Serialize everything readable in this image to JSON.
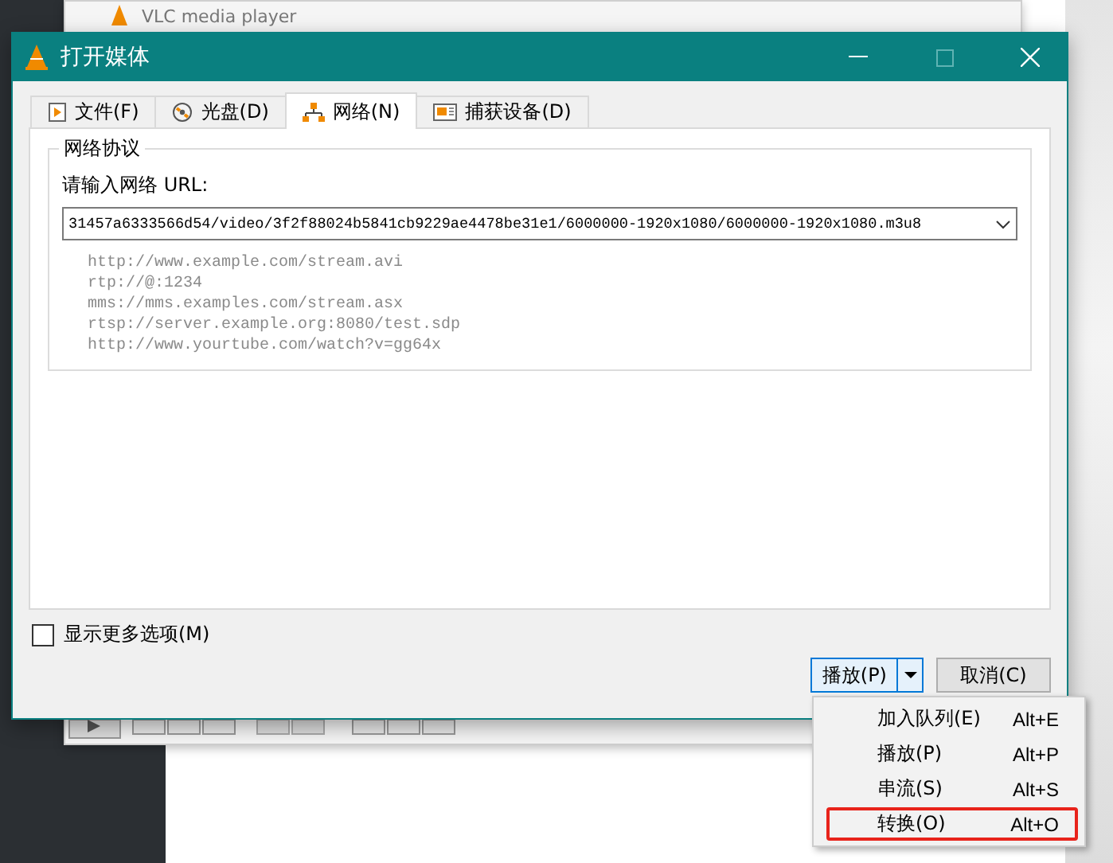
{
  "background_window": {
    "title": "VLC media player"
  },
  "dialog": {
    "title": "打开媒体"
  },
  "tabs": [
    {
      "label": "文件(F)",
      "kind": "file",
      "selected": false
    },
    {
      "label": "光盘(D)",
      "kind": "disc",
      "selected": false
    },
    {
      "label": "网络(N)",
      "kind": "network",
      "selected": true
    },
    {
      "label": "捕获设备(D)",
      "kind": "capture",
      "selected": false
    }
  ],
  "network": {
    "title": "网络协议",
    "url_label": "请输入网络 URL:",
    "url_value": "31457a6333566d54/video/3f2f88024b5841cb9229ae4478be31e1/6000000-1920x1080/6000000-1920x1080.m3u8",
    "examples": [
      "http://www.example.com/stream.avi",
      "rtp://@:1234",
      "mms://mms.examples.com/stream.asx",
      "rtsp://server.example.org:8080/test.sdp",
      "http://www.yourtube.com/watch?v=gg64x"
    ]
  },
  "more_options": {
    "label": "显示更多选项(M)",
    "checked": false
  },
  "buttons": {
    "play": "播放(P)",
    "cancel": "取消(C)"
  },
  "menu": [
    {
      "label": "加入队列(E)",
      "shortcut": "Alt+E",
      "highlighted": false
    },
    {
      "label": "播放(P)",
      "shortcut": "Alt+P",
      "highlighted": false
    },
    {
      "label": "串流(S)",
      "shortcut": "Alt+S",
      "highlighted": false
    },
    {
      "label": "转换(O)",
      "shortcut": "Alt+O",
      "highlighted": true
    }
  ]
}
